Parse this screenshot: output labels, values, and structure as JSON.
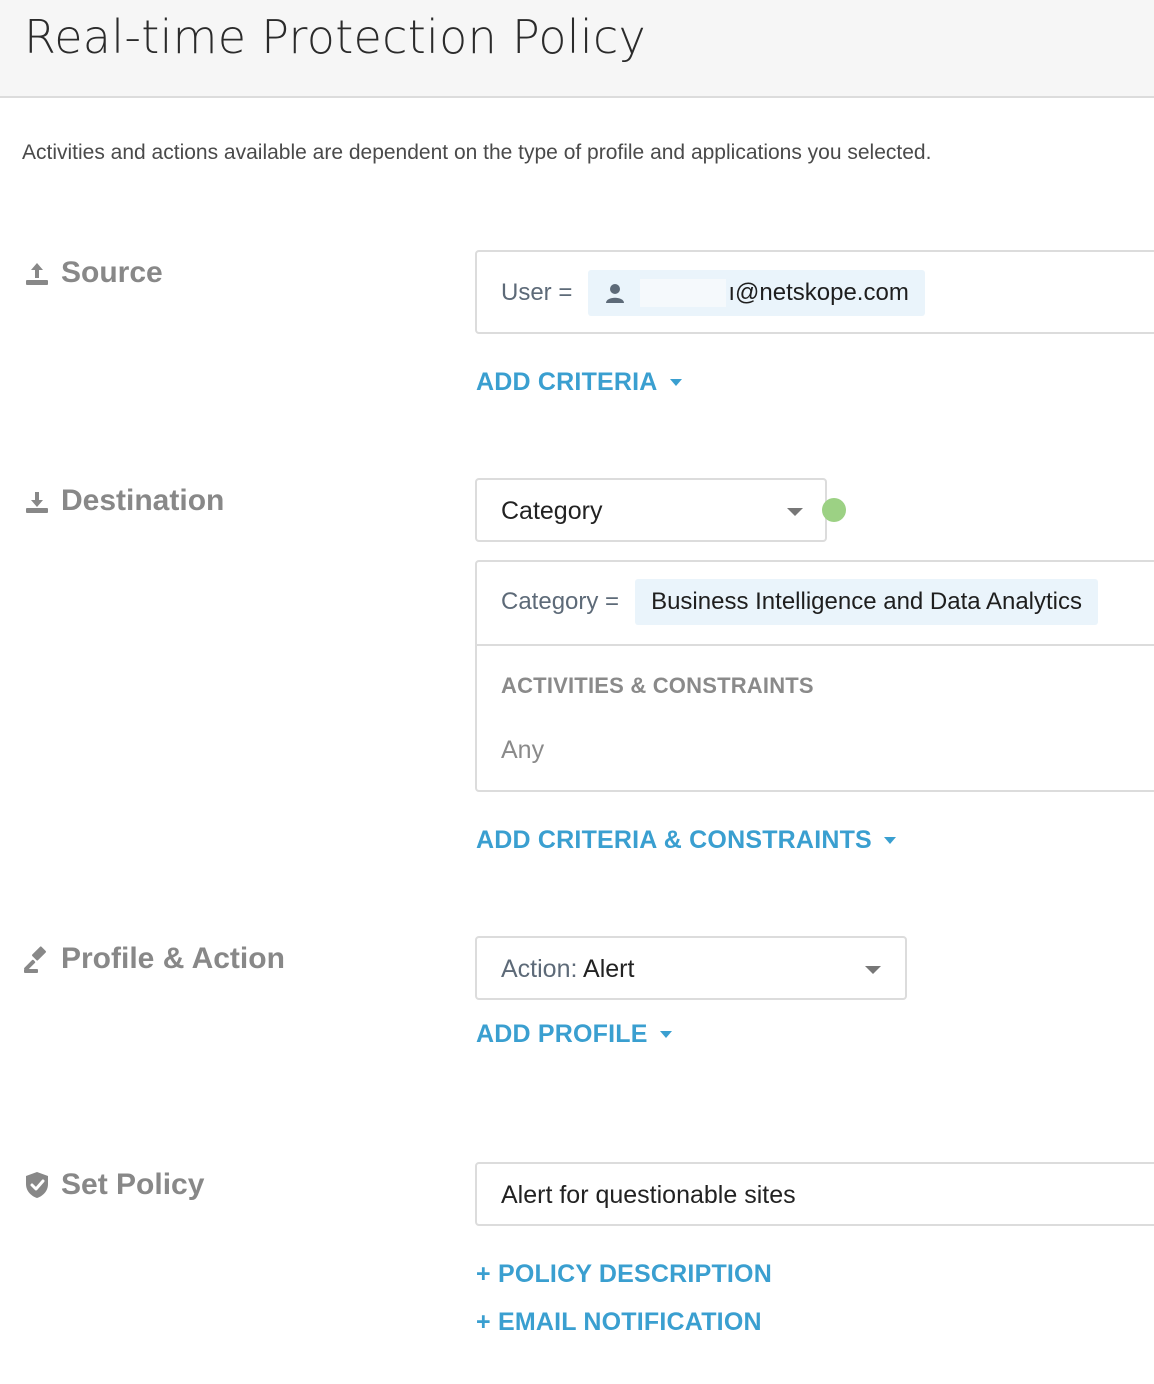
{
  "header": {
    "title": "Real-time Protection Policy"
  },
  "intro_text": "Activities and actions available are dependent on the type of profile and applications you selected.",
  "source": {
    "label": "Source",
    "icon": "upload-icon",
    "criteria_key": "User =",
    "criteria_value": "ı@netskope.com",
    "add_link": "ADD CRITERIA"
  },
  "destination": {
    "label": "Destination",
    "icon": "download-icon",
    "type_select": "Category",
    "status_color": "#9cd184",
    "criteria_key": "Category =",
    "criteria_value": "Business Intelligence and Data Analytics",
    "activities_header": "ACTIVITIES & CONSTRAINTS",
    "activities_value": "Any",
    "add_link": "ADD CRITERIA & CONSTRAINTS"
  },
  "profile_action": {
    "label": "Profile & Action",
    "icon": "gavel-icon",
    "action_key": "Action:",
    "action_value": "Alert",
    "add_link": "ADD PROFILE"
  },
  "set_policy": {
    "label": "Set Policy",
    "icon": "shield-check-icon",
    "policy_name": "Alert for questionable sites",
    "description_link": "+ POLICY DESCRIPTION",
    "email_link": "+ EMAIL NOTIFICATION"
  },
  "colors": {
    "accent": "#3a9fd0",
    "chip_bg": "#eaf4fb"
  }
}
